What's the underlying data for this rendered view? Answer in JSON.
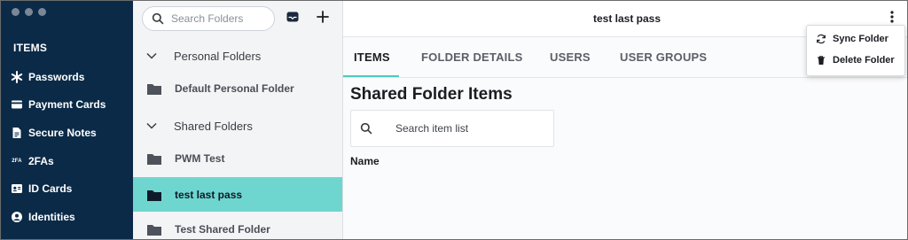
{
  "sidebar": {
    "section_title": "ITEMS",
    "items": [
      {
        "label": "Passwords",
        "icon": "asterisk-icon"
      },
      {
        "label": "Payment Cards",
        "icon": "credit-card-icon"
      },
      {
        "label": "Secure Notes",
        "icon": "note-icon"
      },
      {
        "label": "2FAs",
        "icon": "2fa-icon",
        "icon_text": "2FA"
      },
      {
        "label": "ID Cards",
        "icon": "id-card-icon"
      },
      {
        "label": "Identities",
        "icon": "person-icon"
      }
    ]
  },
  "folders": {
    "search_placeholder": "Search Folders",
    "groups": [
      {
        "label": "Personal Folders",
        "folders": [
          "Default Personal Folder"
        ]
      },
      {
        "label": "Shared Folders",
        "folders": [
          "PWM Test",
          "test last pass",
          "Test Shared Folder"
        ]
      }
    ],
    "active_folder": "test last pass"
  },
  "main": {
    "title": "test last pass",
    "tabs": [
      {
        "label": "ITEMS",
        "active": true
      },
      {
        "label": "FOLDER DETAILS",
        "active": false
      },
      {
        "label": "USERS",
        "active": false
      },
      {
        "label": "USER GROUPS",
        "active": false
      }
    ],
    "section_title": "Shared Folder Items",
    "search_placeholder": "Search item list",
    "column_header": "Name"
  },
  "menu": {
    "items": [
      {
        "label": "Sync Folder",
        "icon": "sync-icon"
      },
      {
        "label": "Delete Folder",
        "icon": "trash-icon"
      }
    ]
  },
  "colors": {
    "sidebar_bg": "#0b2a47",
    "accent": "#6fd6cf",
    "tab_underline": "#4fc9c0"
  }
}
